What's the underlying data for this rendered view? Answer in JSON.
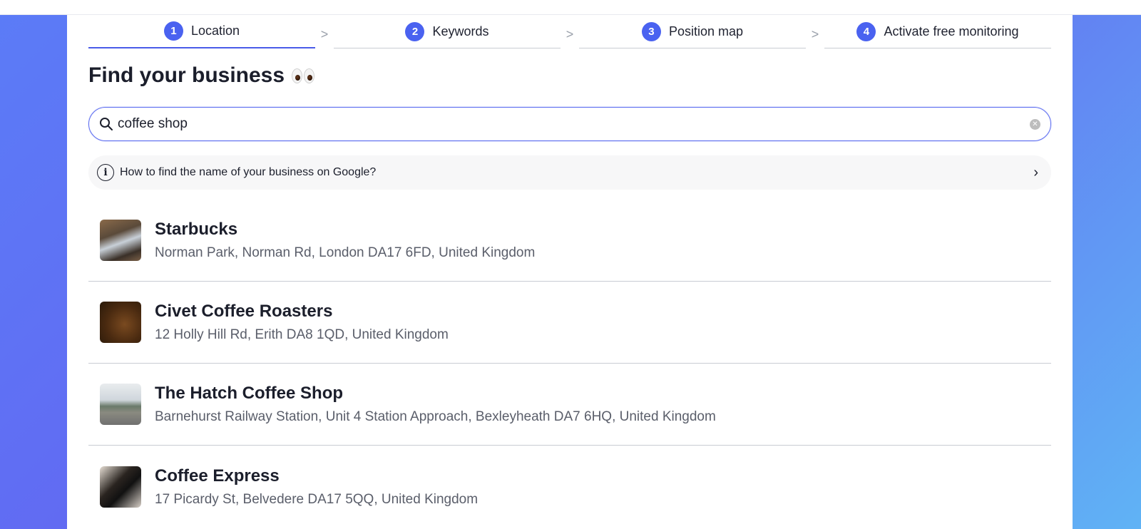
{
  "steps": [
    {
      "number": "1",
      "label": "Location"
    },
    {
      "number": "2",
      "label": "Keywords"
    },
    {
      "number": "3",
      "label": "Position map"
    },
    {
      "number": "4",
      "label": "Activate free monitoring"
    }
  ],
  "active_step": 1,
  "colors": {
    "accent": "#4a62f0",
    "text": "#1b1e2b",
    "muted": "#5a5e6a"
  },
  "page_title": "Find your business",
  "title_emoji": "eyes-icon",
  "search": {
    "value": "coffee shop",
    "placeholder": ""
  },
  "help": {
    "text": "How to find the name of your business on Google?"
  },
  "results": [
    {
      "name": "Starbucks",
      "address": "Norman Park, Norman Rd, London DA17 6FD, United Kingdom"
    },
    {
      "name": "Civet Coffee Roasters",
      "address": "12 Holly Hill Rd, Erith DA8 1QD, United Kingdom"
    },
    {
      "name": "The Hatch Coffee Shop",
      "address": "Barnehurst Railway Station, Unit 4 Station Approach, Bexleyheath DA7 6HQ, United Kingdom"
    },
    {
      "name": "Coffee Express",
      "address": "17 Picardy St, Belvedere DA17 5QQ, United Kingdom"
    }
  ]
}
